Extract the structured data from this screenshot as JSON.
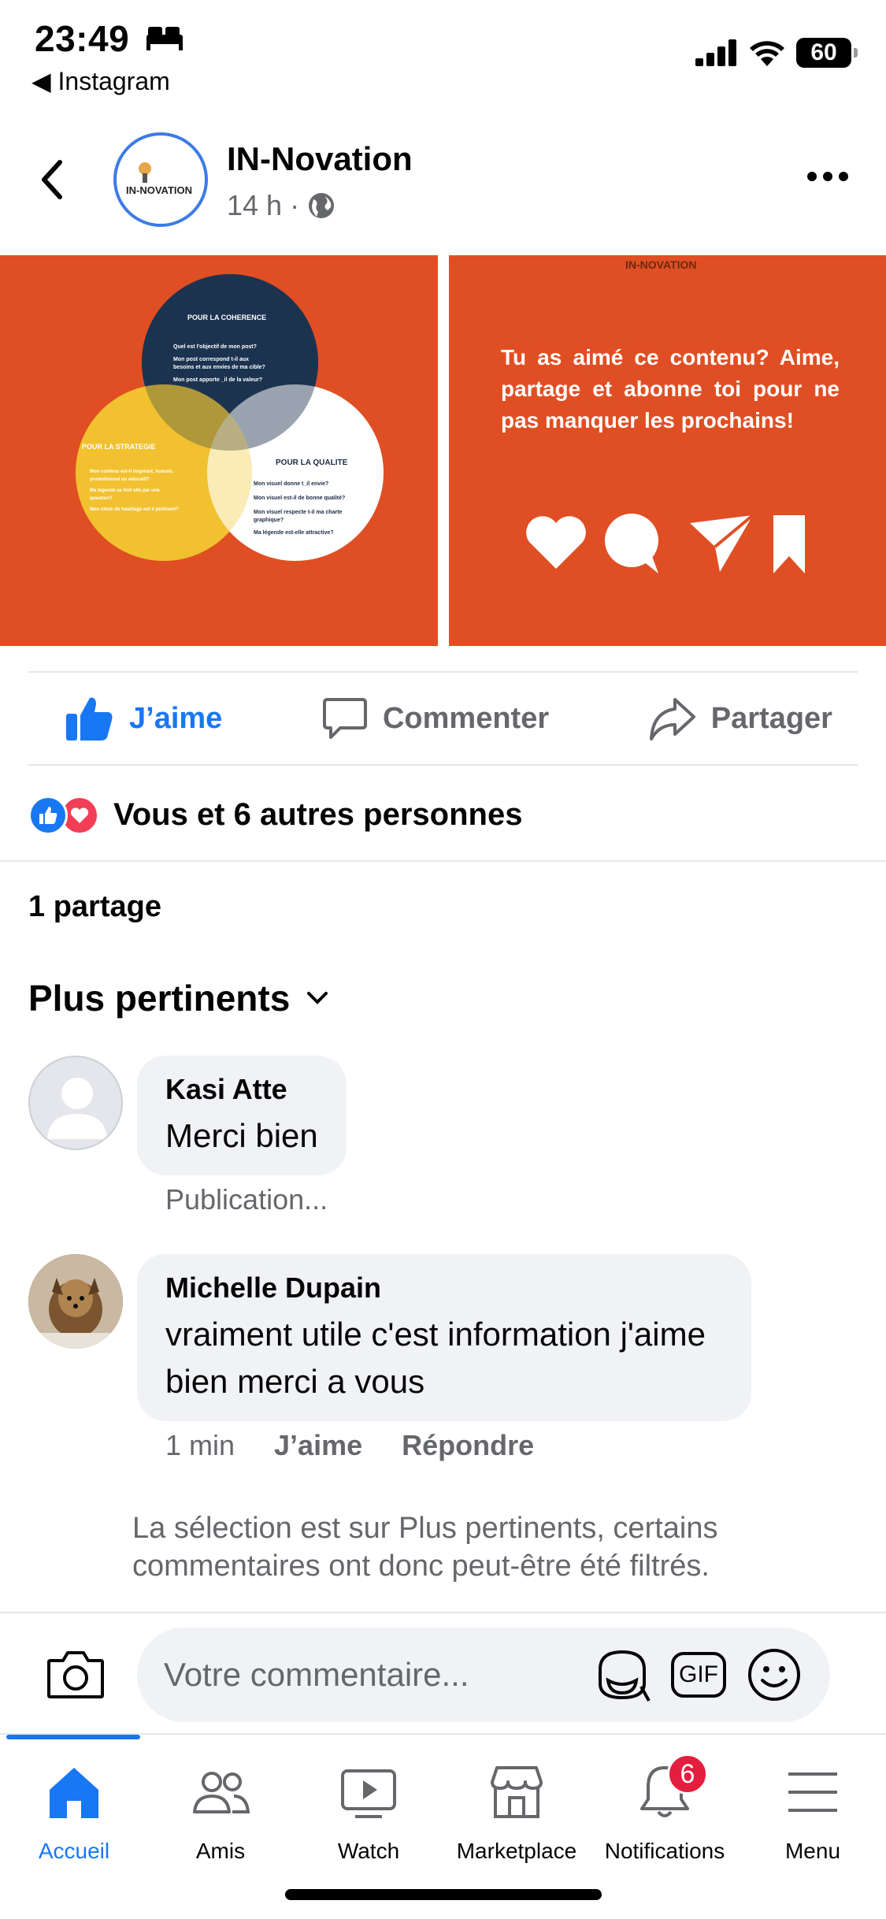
{
  "status_bar": {
    "time": "23:49",
    "back_app": "Instagram",
    "battery": "60"
  },
  "post": {
    "page_name": "IN-Novation",
    "page_logo_text": "IN-NOVATION",
    "time_ago": "14 h",
    "separator": "·",
    "left_image": {
      "top_label": "POUR LA COHERENCE",
      "top_lines": [
        "Quel est l'objectif de mon post?",
        "Mon post correspond t-il aux",
        "besoins et aux envies de ma cible?",
        "Mon post apporte _il de la valeur?"
      ],
      "left_label": "POUR LA STRATEGIE",
      "left_lines": [
        "Mon contenu est-il inspirant, humain,",
        "promotionnel ou educatif?",
        "Ma légende se finit elle par une",
        "question?",
        "Mon choix de hashtags est il pertinent?"
      ],
      "right_label": "POUR LA QUALITE",
      "right_lines": [
        "Mon visuel donne t_il envie?",
        "Mon visuel est-il de bonne qualité?",
        "Mon visuel respecte t-il ma charte",
        "graphique?",
        "Ma légende est-elle attractive?"
      ]
    },
    "right_image": {
      "brand": "IN-NOVATION",
      "text": "Tu as aimé ce contenu? Aime, partage et abonne toi pour ne pas manquer les prochains!"
    }
  },
  "actions": {
    "like": "J’aime",
    "comment": "Commenter",
    "share": "Partager"
  },
  "reactions_summary": "Vous et 6 autres personnes",
  "shares_count": "1 partage",
  "sort_label": "Plus pertinents",
  "comments": [
    {
      "author": "Kasi Atte",
      "text": "Merci bien",
      "sub": "Publication..."
    },
    {
      "author": "Michelle Dupain",
      "text": "vraiment utile c'est information j'aime bien merci a vous",
      "time": "1 min",
      "like": "J’aime",
      "reply": "Répondre"
    }
  ],
  "filter_note": "La sélection est sur Plus pertinents, certains commentaires ont donc peut-être été filtrés.",
  "composer": {
    "placeholder": "Votre commentaire...",
    "gif": "GIF"
  },
  "tabs": [
    {
      "label": "Accueil",
      "icon": "home-icon",
      "active": true
    },
    {
      "label": "Amis",
      "icon": "friends-icon"
    },
    {
      "label": "Watch",
      "icon": "watch-icon"
    },
    {
      "label": "Marketplace",
      "icon": "marketplace-icon"
    },
    {
      "label": "Notifications",
      "icon": "bell-icon",
      "badge": "6"
    },
    {
      "label": "Menu",
      "icon": "menu-icon"
    }
  ],
  "colors": {
    "facebook_blue": "#1877f2",
    "image_orange": "#e04e23",
    "muted_text": "#65676b",
    "badge_red": "#e41e3f"
  }
}
